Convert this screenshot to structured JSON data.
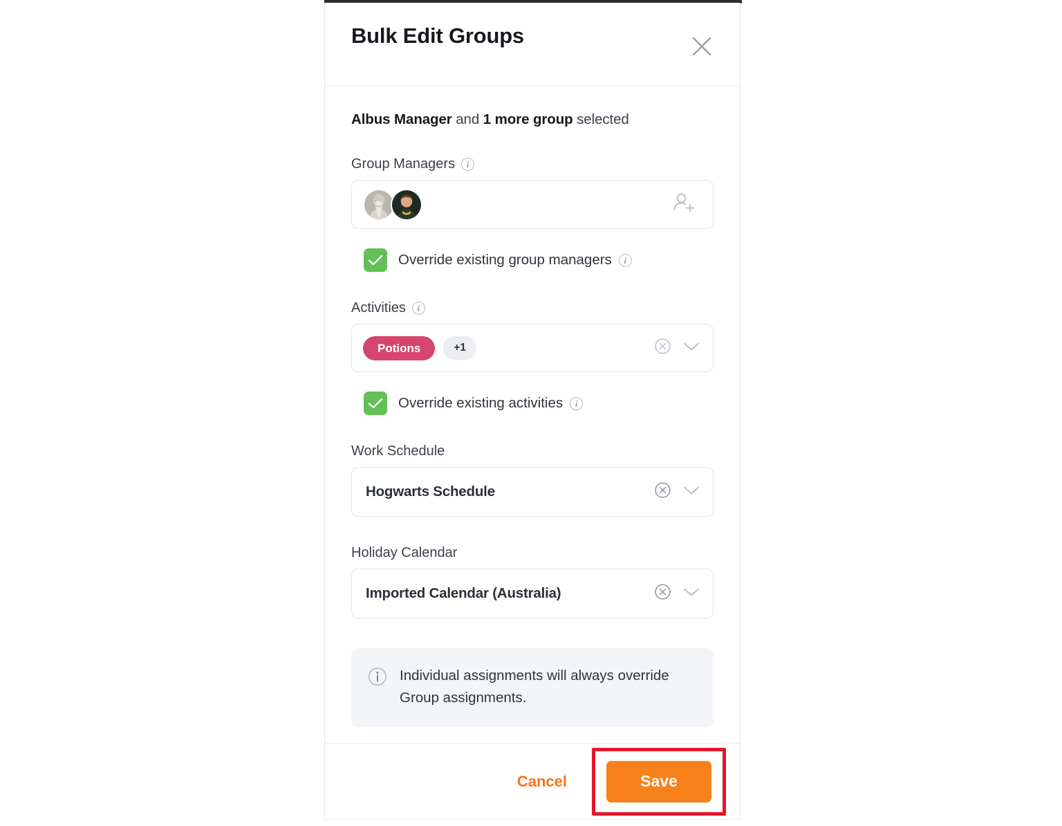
{
  "modal": {
    "title": "Bulk Edit Groups",
    "close_icon": "close-icon",
    "selection": {
      "group_name": "Albus Manager",
      "conjunction": " and ",
      "more_groups": "1 more group",
      "suffix": " selected"
    },
    "group_managers": {
      "label": "Group Managers",
      "info_icon": "info-icon",
      "add_person_icon": "person-add-icon",
      "avatars": [
        {
          "name": "albus-dumbledore-avatar"
        },
        {
          "name": "minerva-mcgonagall-avatar"
        }
      ],
      "override": {
        "label": "Override existing group managers",
        "checked": true,
        "info_icon": "info-icon"
      }
    },
    "activities": {
      "label": "Activities",
      "info_icon": "info-icon",
      "chips": [
        "Potions"
      ],
      "overflow_badge": "+1",
      "clear_icon": "clear-circle-icon",
      "chevron_icon": "chevron-down-icon",
      "override": {
        "label": "Override existing activities",
        "checked": true,
        "info_icon": "info-icon"
      }
    },
    "work_schedule": {
      "label": "Work Schedule",
      "value": "Hogwarts Schedule",
      "clear_icon": "clear-circle-icon",
      "chevron_icon": "chevron-down-icon"
    },
    "holiday_calendar": {
      "label": "Holiday Calendar",
      "value": "Imported Calendar (Australia)",
      "clear_icon": "clear-circle-icon",
      "chevron_icon": "chevron-down-icon"
    },
    "info_banner": {
      "icon": "info-icon",
      "text": "Individual assignments will always override Group assignments."
    },
    "footer": {
      "cancel_label": "Cancel",
      "save_label": "Save"
    }
  },
  "colors": {
    "accent_orange": "#f7821b",
    "cancel_orange": "#f97316",
    "checkbox_green": "#63bf56",
    "chip_pink": "#d6456e",
    "highlight_red": "#e5162a",
    "banner_bg": "#f3f5f8",
    "border_grey": "#e2e5e9"
  }
}
